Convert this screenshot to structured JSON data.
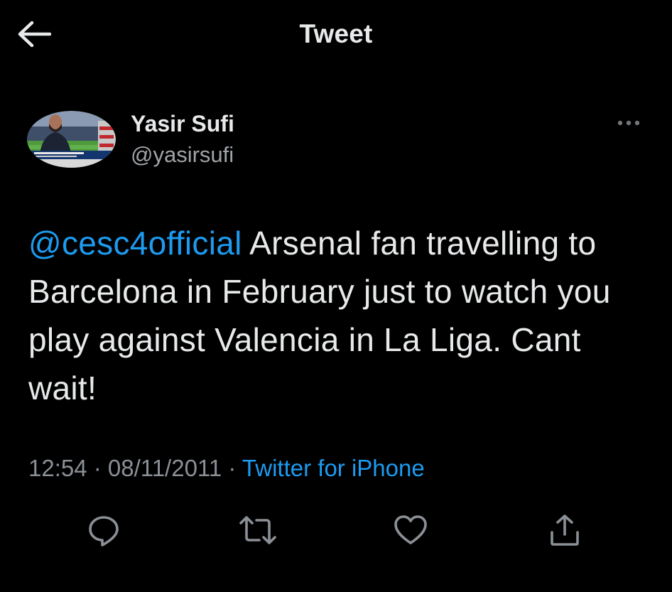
{
  "header": {
    "back_icon": "arrow-left-icon",
    "title": "Tweet"
  },
  "author": {
    "display_name": "Yasir Sufi",
    "handle": "@yasirsufi",
    "more_icon": "more-options-icon"
  },
  "tweet": {
    "mention": "@cesc4official",
    "text": " Arsenal fan travelling to Barcelona in February just to watch you play against Valencia in La Liga. Cant wait!"
  },
  "meta": {
    "time": "12:54",
    "separator": " · ",
    "date": "08/11/2011",
    "source": "Twitter for iPhone"
  },
  "actions": [
    {
      "name": "reply",
      "icon": "reply-icon"
    },
    {
      "name": "retweet",
      "icon": "retweet-icon"
    },
    {
      "name": "like",
      "icon": "heart-icon"
    },
    {
      "name": "share",
      "icon": "share-icon"
    }
  ],
  "colors": {
    "background": "#000000",
    "text": "#E7E9EA",
    "secondary_text": "#8B9096",
    "accent": "#1D9BF0"
  }
}
